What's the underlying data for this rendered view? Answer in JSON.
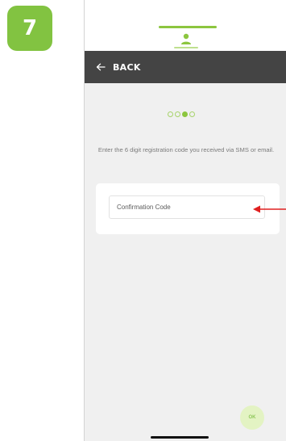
{
  "step_badge": "7",
  "header": {
    "user_icon": "user-icon",
    "accent_color": "#8cc63f"
  },
  "nav": {
    "back_icon": "arrow-left-icon",
    "back_label": "BACK"
  },
  "progress": {
    "total_steps": 4,
    "current_step": 3
  },
  "instruction": "Enter the 6 digit registration code you received via SMS or email.",
  "confirmation": {
    "placeholder": "Confirmation Code",
    "value": ""
  },
  "annotation": {
    "arrow_icon": "red-arrow-pointer-icon",
    "color": "#e02020"
  },
  "ok_button": {
    "label": "OK"
  }
}
